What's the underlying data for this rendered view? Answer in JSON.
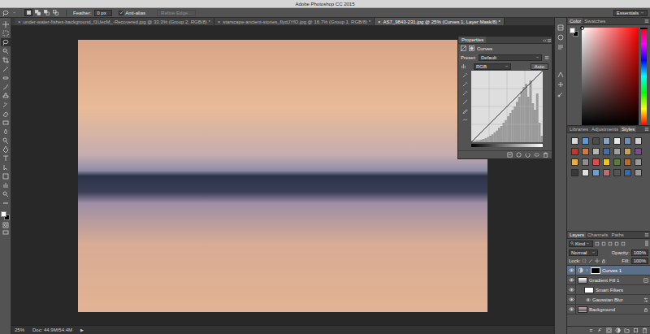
{
  "window": {
    "title": "Adobe Photoshop CC 2015",
    "workspace": "Essentials"
  },
  "options_bar": {
    "selection_modes": [
      {
        "selected": true
      },
      {
        "selected": false
      },
      {
        "selected": false
      },
      {
        "selected": false
      }
    ],
    "feather_label": "Feather:",
    "feather_value": "0 px",
    "anti_alias_label": "Anti-alias",
    "anti_alias_checked": true,
    "refine_edge_label": "Refine Edge...",
    "refine_edge_disabled": true
  },
  "toolbar": {
    "tools": [
      {
        "selected": false
      },
      {
        "selected": false
      },
      {
        "selected": true
      },
      {
        "selected": false
      },
      {
        "selected": false
      },
      {
        "selected": false
      },
      {
        "selected": false
      },
      {
        "selected": false
      },
      {
        "selected": false
      },
      {
        "selected": false
      },
      {
        "selected": false
      },
      {
        "selected": false
      },
      {
        "selected": false
      },
      {
        "selected": false
      },
      {
        "selected": false
      },
      {
        "selected": false
      },
      {
        "selected": false
      },
      {
        "selected": false
      },
      {
        "selected": false
      },
      {
        "selected": false
      },
      {
        "selected": false
      }
    ],
    "foreground_color": "#ffffff",
    "background_color": "#000000"
  },
  "document_tabs": [
    {
      "close": "×",
      "label": "under-water-fishes-background_f1UecM_-Recovered.jpg @ 33.3% (Group 2, RGB/8) *",
      "selected": false
    },
    {
      "close": "×",
      "label": "starscape-ancient-stones_flydJYfO.jpg @ 16.7% (Group 1, RGB/8) *",
      "selected": false
    },
    {
      "close": "×",
      "label": "AS7_9843-231.jpg @ 25% (Curves 1, Layer Mask/8) *",
      "selected": true
    }
  ],
  "properties": {
    "title": "Properties",
    "adjustment": "Curves",
    "preset_label": "Preset:",
    "preset": "Default",
    "channel": "RGB",
    "auto": "Auto",
    "histogram": [
      0.02,
      0.02,
      0.03,
      0.03,
      0.04,
      0.05,
      0.06,
      0.08,
      0.1,
      0.12,
      0.15,
      0.18,
      0.22,
      0.25,
      0.3,
      0.34,
      0.4,
      0.45,
      0.5,
      0.55,
      0.62,
      0.7,
      0.78,
      0.85,
      0.9,
      0.7,
      0.95,
      0.6,
      0.5,
      0.75,
      0.3,
      0.1
    ]
  },
  "color_panel": {
    "tabs": [
      {
        "label": "Color",
        "selected": true
      },
      {
        "label": "Swatches",
        "selected": false
      }
    ],
    "hue_level": 0
  },
  "styles_panel": {
    "tabs": [
      {
        "label": "Libraries",
        "selected": false
      },
      {
        "label": "Adjustments",
        "selected": false
      },
      {
        "label": "Styles",
        "selected": true
      }
    ],
    "styles": [
      {
        "color": "#d9d9d9"
      },
      {
        "color": "#5b9bd5"
      },
      {
        "color": "#4b4b4b"
      },
      {
        "color": "#8aa3c2"
      },
      {
        "color": "#e8e8e8"
      },
      {
        "color": "#6f8fb5"
      },
      {
        "color": "#cfcfcf"
      },
      {
        "color": "#c0392b"
      },
      {
        "color": "#d67a3a"
      },
      {
        "color": "#b5b5b5"
      },
      {
        "color": "#3d6fb0"
      },
      {
        "color": "#a0a0a0"
      },
      {
        "color": "#c9a24a"
      },
      {
        "color": "#7a4d8c"
      },
      {
        "color": "#e3b04b"
      },
      {
        "color": "#8e8e8e"
      },
      {
        "color": "#d94f4f"
      },
      {
        "color": "#f0c419"
      },
      {
        "color": "#5c7a3e"
      },
      {
        "color": "#b86b2e"
      },
      {
        "color": "#9a9a9a"
      },
      {
        "color": "#3a3a3a"
      },
      {
        "color": "#e0e0e0"
      },
      {
        "color": "#6aa0d8"
      },
      {
        "color": "#c46a6a"
      },
      {
        "color": "#555555"
      },
      {
        "color": "#2f6db5"
      },
      {
        "color": "#999999"
      }
    ]
  },
  "layers_panel": {
    "tabs": [
      {
        "label": "Layers",
        "selected": true
      },
      {
        "label": "Channels",
        "selected": false
      },
      {
        "label": "Paths",
        "selected": false
      }
    ],
    "filter": "Kind",
    "blend_mode": "Normal",
    "opacity_label": "Opacity:",
    "opacity": "100%",
    "lock_label": "Lock:",
    "fill_label": "Fill:",
    "fill": "100%",
    "layers": [
      {
        "name": "Curves 1",
        "kind": "adjustment",
        "visible": true,
        "selected": true
      },
      {
        "name": "Gradient Fill 1",
        "kind": "gradient",
        "visible": true,
        "selected": false
      },
      {
        "name": "Smart Filters",
        "kind": "filter-group",
        "visible": true,
        "selected": false
      },
      {
        "name": "Gaussian Blur",
        "kind": "filter",
        "visible": true,
        "selected": false
      },
      {
        "name": "Background",
        "kind": "background",
        "visible": true,
        "selected": false
      }
    ]
  },
  "status_bar": {
    "zoom": "25%",
    "doc": "Doc: 44.9M/54.4M",
    "arrow": "▶"
  }
}
